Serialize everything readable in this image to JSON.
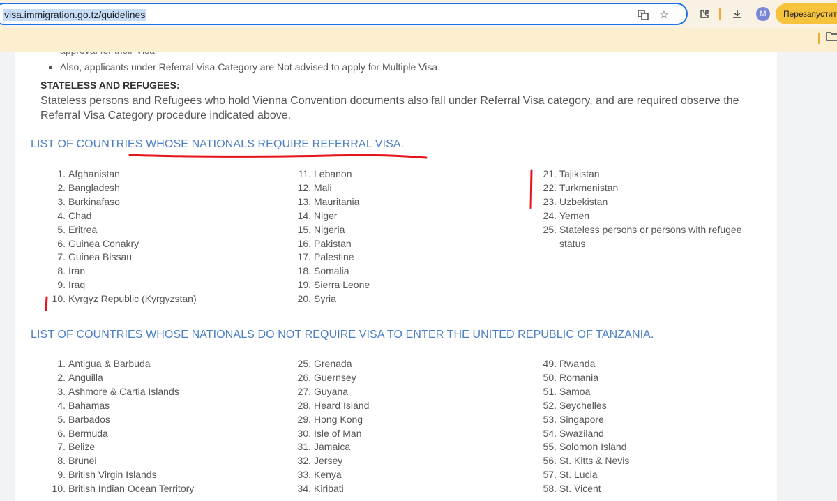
{
  "browser": {
    "url": "visa.immigration.go.tz/guidelines",
    "relaunch_label": "Перезапустить",
    "avatar_letter": "M",
    "accent": "#1a73e8"
  },
  "icons": [
    "site-info-icon",
    "translate-icon",
    "star-icon",
    "extensions-icon",
    "download-icon",
    "folder-icon"
  ],
  "top_fragment": "approval for their Visa",
  "bullet_note": "Also, applicants under Referral Visa Category are Not advised to apply for Multiple Visa.",
  "stateless": {
    "heading": "STATELESS AND REFUGEES:",
    "text": "Stateless persons and Refugees who hold Vienna Convention documents also fall under Referral Visa category, and are required observe the Referral Visa Category procedure indicated above."
  },
  "referral": {
    "title": "LIST OF COUNTRIES WHOSE NATIONALS REQUIRE REFERRAL VISA.",
    "columns": [
      [
        {
          "n": "1.",
          "name": "Afghanistan"
        },
        {
          "n": "2.",
          "name": "Bangladesh"
        },
        {
          "n": "3.",
          "name": "Burkinafaso"
        },
        {
          "n": "4.",
          "name": "Chad"
        },
        {
          "n": "5.",
          "name": "Eritrea"
        },
        {
          "n": "6.",
          "name": "Guinea Conakry"
        },
        {
          "n": "7.",
          "name": "Guinea Bissau"
        },
        {
          "n": "8.",
          "name": "Iran"
        },
        {
          "n": "9.",
          "name": "Iraq"
        },
        {
          "n": "10.",
          "name": "Kyrgyz Republic (Kyrgyzstan)"
        }
      ],
      [
        {
          "n": "11.",
          "name": "Lebanon"
        },
        {
          "n": "12.",
          "name": "Mali"
        },
        {
          "n": "13.",
          "name": "Mauritania"
        },
        {
          "n": "14.",
          "name": "Niger"
        },
        {
          "n": "15.",
          "name": "Nigeria"
        },
        {
          "n": "16.",
          "name": "Pakistan"
        },
        {
          "n": "17.",
          "name": "Palestine"
        },
        {
          "n": "18.",
          "name": "Somalia"
        },
        {
          "n": "19.",
          "name": "Sierra Leone"
        },
        {
          "n": "20.",
          "name": "Syria"
        }
      ],
      [
        {
          "n": "21.",
          "name": "Tajikistan"
        },
        {
          "n": "22.",
          "name": "Turkmenistan"
        },
        {
          "n": "23.",
          "name": "Uzbekistan"
        },
        {
          "n": "24.",
          "name": "Yemen"
        },
        {
          "n": "25.",
          "name": "Stateless persons or persons with refugee"
        },
        {
          "n": "",
          "name": "status"
        }
      ]
    ]
  },
  "no_visa": {
    "title": "LIST OF COUNTRIES WHOSE NATIONALS DO NOT REQUIRE VISA TO ENTER THE UNITED REPUBLIC OF TANZANIA.",
    "columns": [
      [
        {
          "n": "1.",
          "name": "Antigua & Barbuda"
        },
        {
          "n": "2.",
          "name": "Anguilla"
        },
        {
          "n": "3.",
          "name": "Ashmore & Cartia Islands"
        },
        {
          "n": "4.",
          "name": "Bahamas"
        },
        {
          "n": "5.",
          "name": "Barbados"
        },
        {
          "n": "6.",
          "name": "Bermuda"
        },
        {
          "n": "7.",
          "name": "Belize"
        },
        {
          "n": "8.",
          "name": "Brunei"
        },
        {
          "n": "9.",
          "name": "British Virgin Islands"
        },
        {
          "n": "10.",
          "name": "British Indian Ocean Territory"
        }
      ],
      [
        {
          "n": "25.",
          "name": "Grenada"
        },
        {
          "n": "26.",
          "name": "Guernsey"
        },
        {
          "n": "27.",
          "name": "Guyana"
        },
        {
          "n": "28.",
          "name": "Heard Island"
        },
        {
          "n": "29.",
          "name": "Hong Kong"
        },
        {
          "n": "30.",
          "name": "Isle of Man"
        },
        {
          "n": "31.",
          "name": "Jamaica"
        },
        {
          "n": "32.",
          "name": "Jersey"
        },
        {
          "n": "33.",
          "name": "Kenya"
        },
        {
          "n": "34.",
          "name": "Kiribati"
        }
      ],
      [
        {
          "n": "49.",
          "name": "Rwanda"
        },
        {
          "n": "50.",
          "name": "Romania"
        },
        {
          "n": "51.",
          "name": "Samoa"
        },
        {
          "n": "52.",
          "name": "Seychelles"
        },
        {
          "n": "53.",
          "name": "Singapore"
        },
        {
          "n": "54.",
          "name": "Swaziland"
        },
        {
          "n": "55.",
          "name": "Solomon Island"
        },
        {
          "n": "56.",
          "name": "St. Kitts & Nevis"
        },
        {
          "n": "57.",
          "name": "St. Lucia"
        },
        {
          "n": "58.",
          "name": "St. Vicent"
        }
      ]
    ]
  },
  "annotation_color": "#e8141c"
}
